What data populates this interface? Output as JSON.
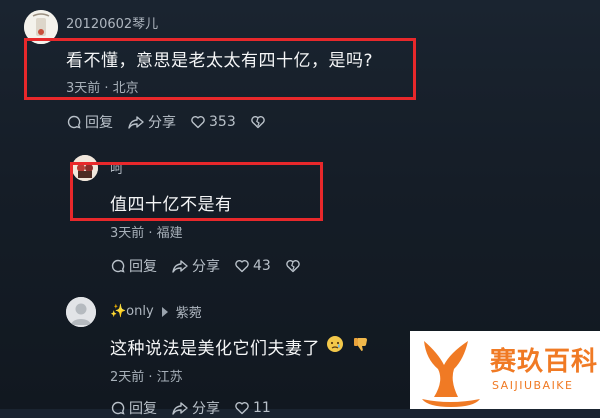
{
  "comments": [
    {
      "username": "20120602琴儿",
      "text": "看不懂，意思是老太太有四十亿，是吗?",
      "meta": "3天前 · 北京",
      "reply_label": "回复",
      "share_label": "分享",
      "like_count": "353"
    },
    {
      "username": "呵",
      "text": "值四十亿不是有",
      "meta": "3天前 · 福建",
      "reply_label": "回复",
      "share_label": "分享",
      "like_count": "43"
    },
    {
      "username": "✨only",
      "reply_to": "紫菀",
      "text": "这种说法是美化它们夫妻了",
      "meta": "2天前 · 江苏",
      "reply_label": "回复",
      "share_label": "分享",
      "like_count": "11"
    }
  ],
  "watermark": {
    "title": "赛玖百科",
    "subtitle": "SAIJIUBAIKE"
  },
  "colors": {
    "highlight_box": "#e8282b",
    "watermark_orange": "#f07a24"
  }
}
